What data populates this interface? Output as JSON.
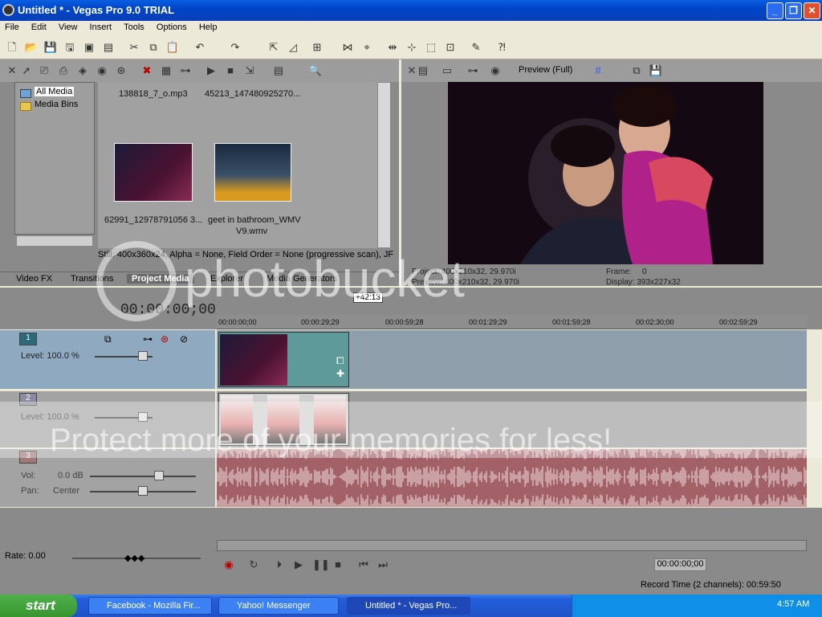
{
  "window": {
    "title": "Untitled * - Vegas Pro 9.0 TRIAL"
  },
  "menu": [
    "File",
    "Edit",
    "View",
    "Insert",
    "Tools",
    "Options",
    "Help"
  ],
  "media": {
    "tree": [
      "All Media",
      "Media Bins"
    ],
    "files": [
      {
        "name": "138818_7_o.mp3"
      },
      {
        "name": "45213_147480925270..."
      },
      {
        "name": "62991_12978791056 3..."
      },
      {
        "name": "geet in bathroom_WMV",
        "name2": "V9.wmv"
      }
    ],
    "status": "Still: 400x360x24, Alpha = None, Field Order = None (progressive scan), JF",
    "tabs": [
      "Video FX",
      "Transitions",
      "Project Media",
      "Explorer",
      "Media Generators"
    ],
    "active_tab": "Project Media"
  },
  "preview": {
    "mode": "Preview (Full)",
    "project": "Project:  400x210x32, 29.970i",
    "preview_line": "Preview:  400x210x32, 29.970i",
    "frame_label": "Frame:",
    "frame_value": "0",
    "display": "Display:   393x227x32"
  },
  "timeline": {
    "timecode": "00:00:00;00",
    "marker": "+42:13",
    "ruler": [
      "00:00:00;00",
      "00:00:29;29",
      "00:00:59;28",
      "00:01:29;29",
      "00:01:59;28",
      "00:02:30;00",
      "00:02:59;29"
    ],
    "tracks": [
      {
        "num": "1",
        "type": "video",
        "level_label": "Level: 100.0 %"
      },
      {
        "num": "2",
        "type": "video",
        "level_label": "Level: 100.0 %"
      },
      {
        "num": "3",
        "type": "audio",
        "vol_label": "Vol:",
        "vol_value": "0.0 dB",
        "pan_label": "Pan:",
        "pan_value": "Center"
      }
    ],
    "rate": "Rate: 0.00",
    "position": "00:00:00;00",
    "record_time": "Record Time (2 channels): 00:59:50"
  },
  "taskbar": {
    "start": "start",
    "tasks": [
      "Facebook - Mozilla Fir...",
      "Yahoo! Messenger",
      "Untitled * - Vegas Pro..."
    ],
    "clock": "4:57 AM"
  },
  "watermark": {
    "brand": "photobucket",
    "slogan": "Protect more of your memories for less!"
  },
  "colors": {
    "titlebar": "#0a5fe0",
    "track1": "#8faac0",
    "audio_wave": "#7a1f2a"
  }
}
